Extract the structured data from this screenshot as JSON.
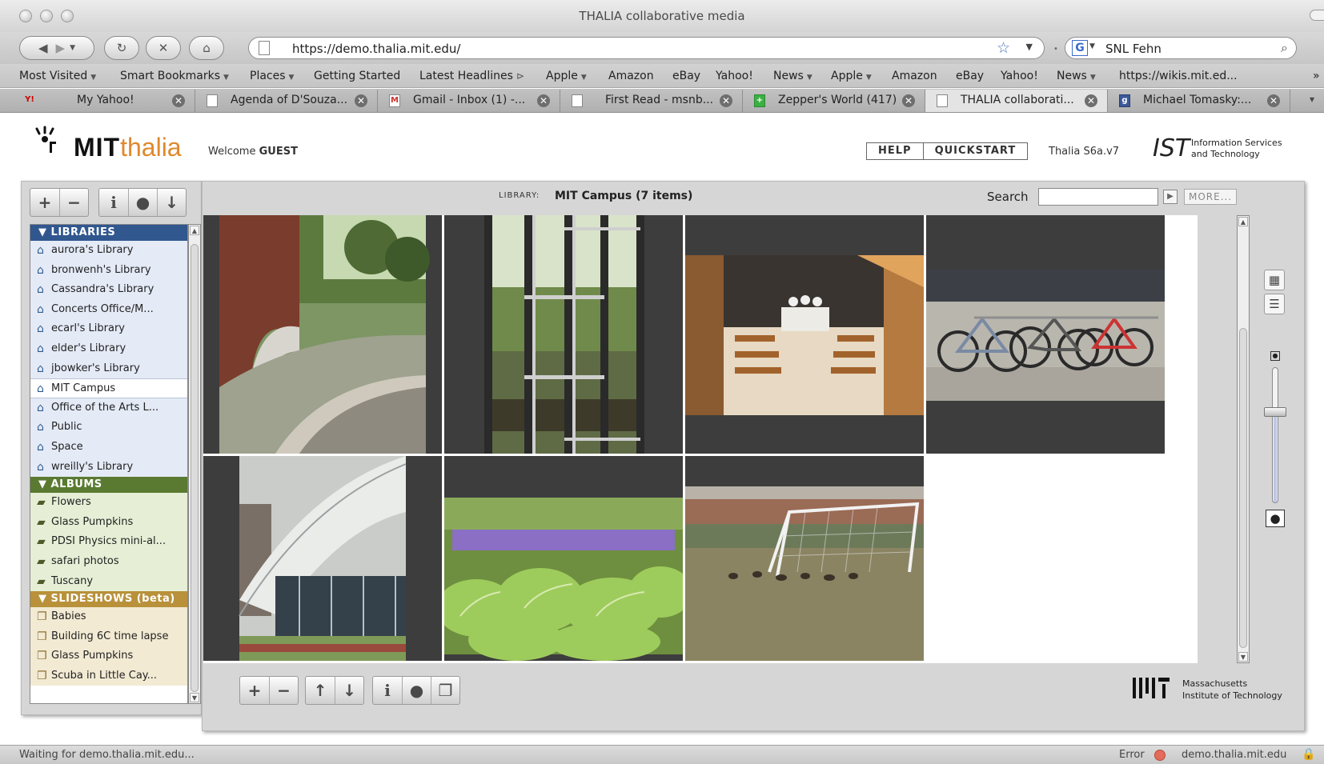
{
  "window": {
    "title": "THALIA collaborative media"
  },
  "browser": {
    "url": "https://demo.thalia.mit.edu/",
    "search_value": "SNL Fehn",
    "bookmarks": [
      {
        "label": "Most Visited",
        "dropdown": true
      },
      {
        "label": "Smart Bookmarks",
        "dropdown": true
      },
      {
        "label": "Places",
        "dropdown": true
      },
      {
        "label": "Getting Started",
        "dropdown": false
      },
      {
        "label": "Latest Headlines",
        "dropdown": false,
        "rss": true
      },
      {
        "label": "Apple",
        "dropdown": true
      },
      {
        "label": "Amazon",
        "dropdown": false
      },
      {
        "label": "eBay",
        "dropdown": false
      },
      {
        "label": "Yahoo!",
        "dropdown": false
      },
      {
        "label": "News",
        "dropdown": true
      },
      {
        "label": "Apple",
        "dropdown": true
      },
      {
        "label": "Amazon",
        "dropdown": false
      },
      {
        "label": "eBay",
        "dropdown": false
      },
      {
        "label": "Yahoo!",
        "dropdown": false
      },
      {
        "label": "News",
        "dropdown": true
      },
      {
        "label": "https://wikis.mit.ed...",
        "dropdown": false
      }
    ],
    "tabs": [
      {
        "label": "My Yahoo!",
        "icon": "yahoo-icon"
      },
      {
        "label": "Agenda of D'Souza...",
        "icon": "page-icon"
      },
      {
        "label": "Gmail - Inbox (1) -...",
        "icon": "gmail-icon"
      },
      {
        "label": "First Read - msnb...",
        "icon": "page-icon"
      },
      {
        "label": "Zepper's World (417)",
        "icon": "plus-icon"
      },
      {
        "label": "THALIA collaborati...",
        "icon": "page-icon",
        "active": true
      },
      {
        "label": "Michael Tomasky:...",
        "icon": "g-icon"
      }
    ],
    "status": "Waiting for demo.thalia.mit.edu...",
    "status_error": "Error",
    "status_domain": "demo.thalia.mit.edu"
  },
  "app": {
    "logo_mit": "MIT",
    "logo_thalia": "thalia",
    "welcome": "Welcome",
    "user": "GUEST",
    "help": "HELP",
    "quickstart": "QUICKSTART",
    "version": "Thalia S6a.v7",
    "ist_logo": "IST",
    "ist_line1": "Information Services",
    "ist_line2": "and Technology",
    "footer_line1": "Massachusetts",
    "footer_line2": "Institute of Technology"
  },
  "sidebar": {
    "libraries_header": "LIBRARIES",
    "libraries": [
      {
        "label": "aurora's Library"
      },
      {
        "label": "bronwenh's Library"
      },
      {
        "label": "Cassandra's Library"
      },
      {
        "label": "Concerts Office/M..."
      },
      {
        "label": "ecarl's Library"
      },
      {
        "label": "elder's Library"
      },
      {
        "label": "jbowker's Library"
      },
      {
        "label": "MIT Campus",
        "selected": true
      },
      {
        "label": "Office of the Arts L..."
      },
      {
        "label": "Public"
      },
      {
        "label": "Space"
      },
      {
        "label": "wreilly's Library"
      }
    ],
    "albums_header": "ALBUMS",
    "albums": [
      {
        "label": "Flowers"
      },
      {
        "label": "Glass Pumpkins"
      },
      {
        "label": "PDSI Physics mini-al..."
      },
      {
        "label": "safari photos"
      },
      {
        "label": "Tuscany"
      }
    ],
    "slideshows_header": "SLIDESHOWS (beta)",
    "slideshows": [
      {
        "label": "Babies"
      },
      {
        "label": "Building 6C time lapse"
      },
      {
        "label": "Glass Pumpkins"
      },
      {
        "label": "Scuba in Little Cay..."
      }
    ]
  },
  "main": {
    "library_label": "LIBRARY:",
    "library_name": "MIT Campus (7 items)",
    "search_label": "Search",
    "more_label": "MORE...",
    "photos": [
      {
        "name": "photo-fountain-brick-wall"
      },
      {
        "name": "photo-window-reflection"
      },
      {
        "name": "photo-chapel-interior"
      },
      {
        "name": "photo-bicycles"
      },
      {
        "name": "photo-kresge-auditorium"
      },
      {
        "name": "photo-hosta-lavender"
      },
      {
        "name": "photo-soccer-goal-geese"
      }
    ]
  },
  "colors": {
    "libraries": "#31578f",
    "albums": "#5a7a31",
    "slideshows": "#b8913a",
    "thalia_orange": "#e0882c"
  }
}
